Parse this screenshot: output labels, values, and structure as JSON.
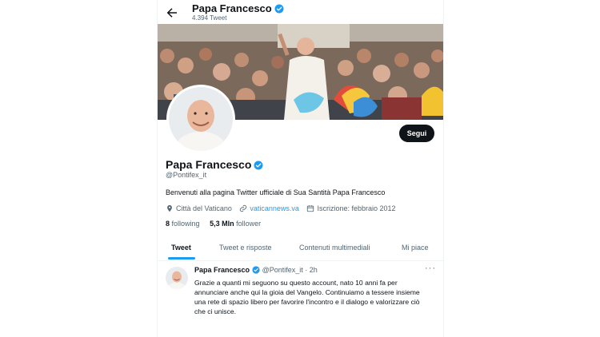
{
  "header": {
    "name": "Papa Francesco",
    "tweet_count": "4.394 Tweet"
  },
  "profile": {
    "name": "Papa Francesco",
    "handle": "@Pontifex_it",
    "bio": "Benvenuti alla pagina Twitter ufficiale di Sua Santità Papa Francesco",
    "location": "Città del Vaticano",
    "website": "vaticannews.va",
    "joined": "Iscrizione: febbraio 2012",
    "following_count": "8",
    "following_label": "following",
    "followers_count": "5,3 Mln",
    "followers_label": "follower",
    "follow_label": "Segui"
  },
  "tabs": [
    "Tweet",
    "Tweet e risposte",
    "Contenuti multimediali",
    "Mi piace"
  ],
  "tweet": {
    "name": "Papa Francesco",
    "handle": "@Pontifex_it",
    "separator": "·",
    "time": "2h",
    "more": "···",
    "text": "Grazie a quanti mi seguono su questo account, nato 10 anni fa per annunciare anche qui la gioia del Vangelo. Continuiamo a tessere insieme una rete di spazio libero per favorire l'incontro e il dialogo e valorizzare ciò che ci unisce."
  },
  "colors": {
    "accent": "#1d9bf0",
    "text": "#0f1419",
    "secondary": "#536471",
    "button": "#0f1419"
  }
}
